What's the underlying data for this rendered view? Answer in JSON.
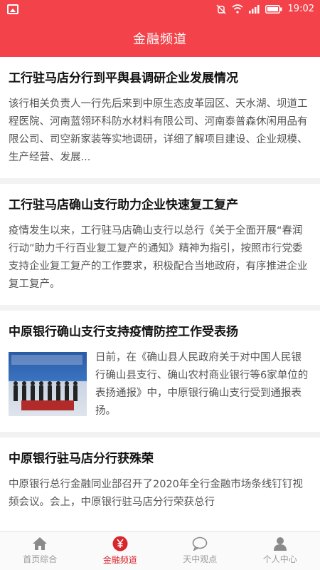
{
  "status_bar": {
    "time": "19:02"
  },
  "header": {
    "title": "金融频道"
  },
  "articles": [
    {
      "title": "工行驻马店分行到平舆县调研企业发展情况",
      "summary": "该行相关负责人一行先后来到中原生态皮革园区、天水湖、坝道工程医院、河南蓝翎环科防水材料有限公司、河南泰普森休闲用品有限公司、司空新家装等实地调研，详细了解项目建设、企业规模、生产经营、发展..."
    },
    {
      "title": "工行驻马店确山支行助力企业快速复工复产",
      "summary": "疫情发生以来，工行驻马店确山支行以总行《关于全面开展“春润行动”助力千行百业复工复产的通知》精神为指引，按照市行党委支持企业复工复产的工作要求，积极配合当地政府，有序推进企业复工复产。"
    },
    {
      "title": "中原银行确山支行支持疫情防控工作受表扬",
      "summary": "日前，在《确山县人民政府关于对中国人民银行确山县支行、确山农村商业银行等6家单位的表扬通报》中，中原银行确山支行受到通报表扬。"
    },
    {
      "title": "中原银行驻马店分行获殊荣",
      "summary": "中原银行总行金融同业部召开了2020年全行金融市场条线钉钉视频会议。会上，中原银行驻马店分行荣获总行"
    }
  ],
  "tabbar": {
    "tabs": [
      {
        "label": "首页综合",
        "icon": "home-icon",
        "active": false
      },
      {
        "label": "金融频道",
        "icon": "yuan-icon",
        "active": true
      },
      {
        "label": "天中观点",
        "icon": "chat-bubble-icon",
        "active": false
      },
      {
        "label": "个人中心",
        "icon": "person-icon",
        "active": false
      }
    ]
  },
  "colors": {
    "brand_red": "#f3424a",
    "active_tab": "#d8262e",
    "inactive_tab": "#9a9a9a"
  }
}
